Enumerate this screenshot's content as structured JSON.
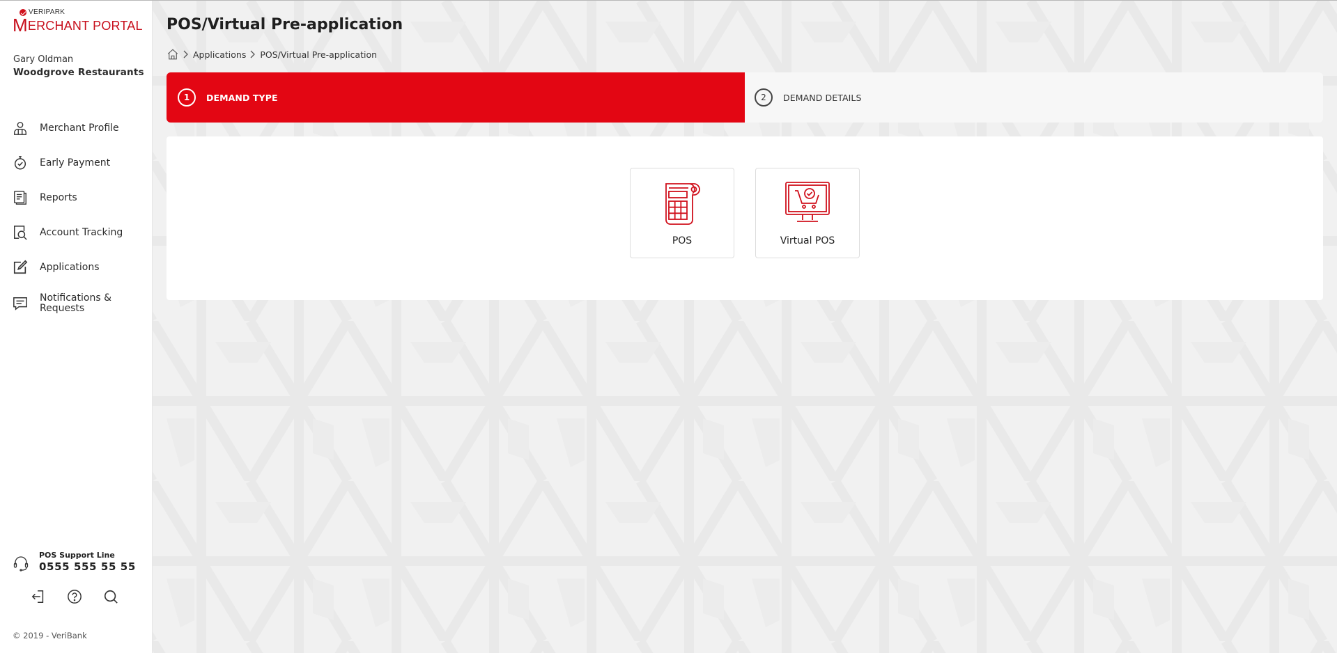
{
  "brand": {
    "company": "VERIPARK",
    "product_initial": "M",
    "product_rest": "ERCHANT PORTAL",
    "accent_color": "#e30613"
  },
  "user": {
    "name": "Gary Oldman",
    "company": "Woodgrove Restaurants"
  },
  "sidebar": {
    "items": [
      {
        "label": "Merchant Profile",
        "icon": "user-profile-icon"
      },
      {
        "label": "Early Payment",
        "icon": "stopwatch-icon"
      },
      {
        "label": "Reports",
        "icon": "document-icon"
      },
      {
        "label": "Account Tracking",
        "icon": "document-search-icon"
      },
      {
        "label": "Applications",
        "icon": "edit-icon"
      },
      {
        "label": "Notifications & Requests",
        "icon": "chat-icon"
      }
    ],
    "support": {
      "label": "POS Support Line",
      "number": "0555 555 55 55"
    },
    "bottom_icons": [
      "logout-icon",
      "help-icon",
      "search-icon"
    ],
    "copyright": "© 2019 - VeriBank"
  },
  "page": {
    "title": "POS/Virtual Pre-application",
    "breadcrumb": [
      "Applications",
      "POS/Virtual Pre-application"
    ]
  },
  "steps": [
    {
      "number": "1",
      "label": "DEMAND TYPE",
      "active": true
    },
    {
      "number": "2",
      "label": "DEMAND DETAILS",
      "active": false
    }
  ],
  "options": [
    {
      "label": "POS",
      "icon": "pos-terminal-icon"
    },
    {
      "label": "Virtual POS",
      "icon": "virtual-pos-icon"
    }
  ]
}
